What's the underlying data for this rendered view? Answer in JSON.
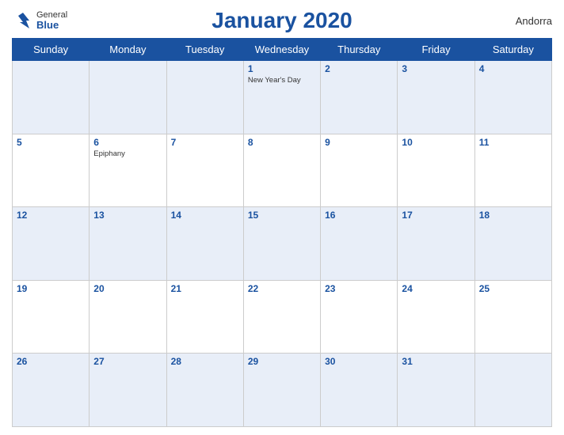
{
  "header": {
    "title": "January 2020",
    "country": "Andorra",
    "logo": {
      "general": "General",
      "blue": "Blue"
    }
  },
  "days_of_week": [
    "Sunday",
    "Monday",
    "Tuesday",
    "Wednesday",
    "Thursday",
    "Friday",
    "Saturday"
  ],
  "weeks": [
    [
      {
        "num": "",
        "holiday": ""
      },
      {
        "num": "",
        "holiday": ""
      },
      {
        "num": "",
        "holiday": ""
      },
      {
        "num": "1",
        "holiday": "New Year's Day"
      },
      {
        "num": "2",
        "holiday": ""
      },
      {
        "num": "3",
        "holiday": ""
      },
      {
        "num": "4",
        "holiday": ""
      }
    ],
    [
      {
        "num": "5",
        "holiday": ""
      },
      {
        "num": "6",
        "holiday": "Epiphany"
      },
      {
        "num": "7",
        "holiday": ""
      },
      {
        "num": "8",
        "holiday": ""
      },
      {
        "num": "9",
        "holiday": ""
      },
      {
        "num": "10",
        "holiday": ""
      },
      {
        "num": "11",
        "holiday": ""
      }
    ],
    [
      {
        "num": "12",
        "holiday": ""
      },
      {
        "num": "13",
        "holiday": ""
      },
      {
        "num": "14",
        "holiday": ""
      },
      {
        "num": "15",
        "holiday": ""
      },
      {
        "num": "16",
        "holiday": ""
      },
      {
        "num": "17",
        "holiday": ""
      },
      {
        "num": "18",
        "holiday": ""
      }
    ],
    [
      {
        "num": "19",
        "holiday": ""
      },
      {
        "num": "20",
        "holiday": ""
      },
      {
        "num": "21",
        "holiday": ""
      },
      {
        "num": "22",
        "holiday": ""
      },
      {
        "num": "23",
        "holiday": ""
      },
      {
        "num": "24",
        "holiday": ""
      },
      {
        "num": "25",
        "holiday": ""
      }
    ],
    [
      {
        "num": "26",
        "holiday": ""
      },
      {
        "num": "27",
        "holiday": ""
      },
      {
        "num": "28",
        "holiday": ""
      },
      {
        "num": "29",
        "holiday": ""
      },
      {
        "num": "30",
        "holiday": ""
      },
      {
        "num": "31",
        "holiday": ""
      },
      {
        "num": "",
        "holiday": ""
      }
    ]
  ]
}
